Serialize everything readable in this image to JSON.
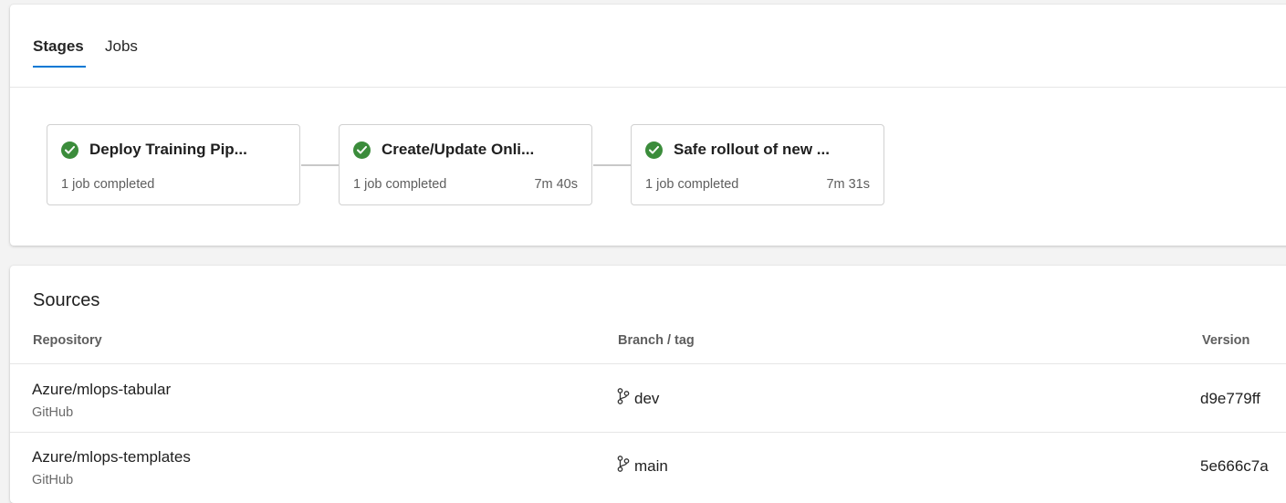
{
  "tabs": [
    {
      "label": "Stages",
      "active": true
    },
    {
      "label": "Jobs",
      "active": false
    }
  ],
  "stages": [
    {
      "name": "Deploy Training Pip...",
      "status": "1 job completed",
      "duration": "",
      "icon": "success-check-icon"
    },
    {
      "name": "Create/Update Onli...",
      "status": "1 job completed",
      "duration": "7m 40s",
      "icon": "success-check-icon"
    },
    {
      "name": "Safe rollout of new ...",
      "status": "1 job completed",
      "duration": "7m 31s",
      "icon": "success-check-icon"
    }
  ],
  "sources": {
    "title": "Sources",
    "columns": {
      "repository": "Repository",
      "branch": "Branch / tag",
      "version": "Version"
    },
    "rows": [
      {
        "repository": "Azure/mlops-tabular",
        "provider": "GitHub",
        "branch": "dev",
        "version": "d9e779ff"
      },
      {
        "repository": "Azure/mlops-templates",
        "provider": "GitHub",
        "branch": "main",
        "version": "5e666c7a"
      }
    ]
  },
  "colors": {
    "accent": "#0078d4",
    "success": "#3b8c3b",
    "background": "#f3f3f3",
    "card": "#ffffff"
  }
}
